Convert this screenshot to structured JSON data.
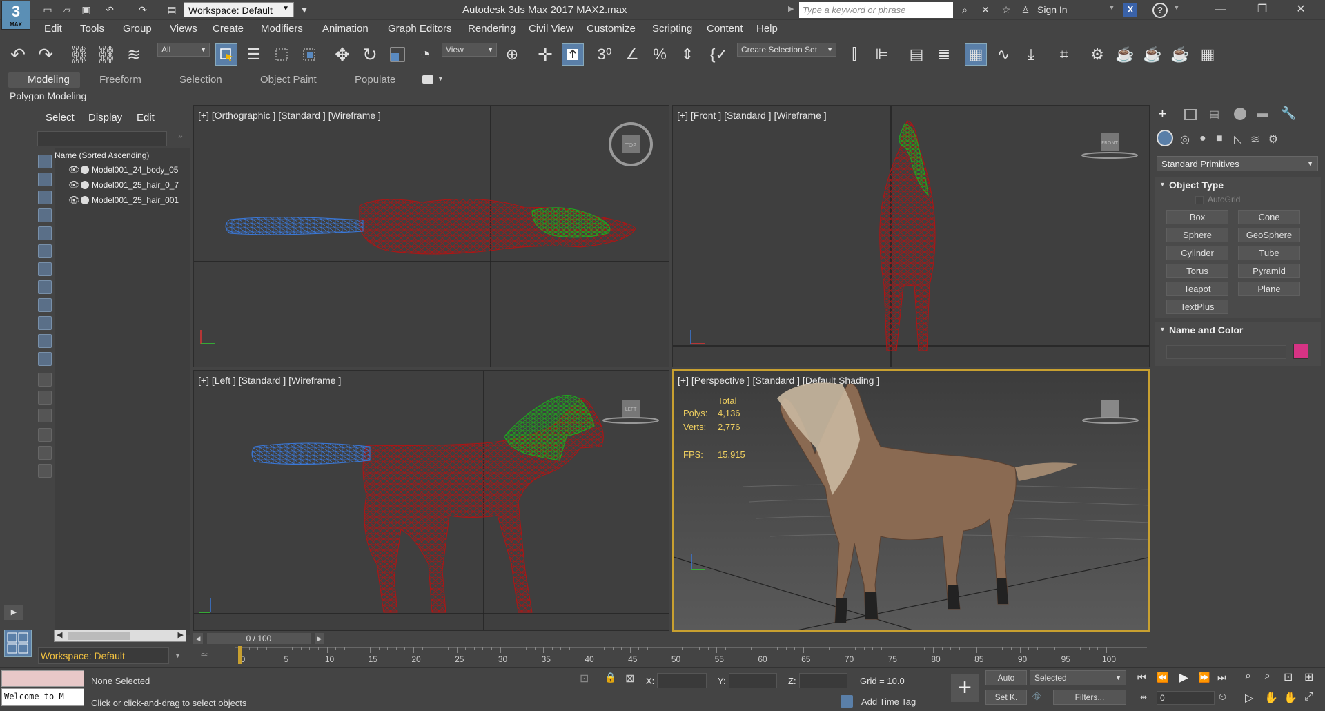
{
  "app": {
    "logo_text": "3",
    "logo_sub": "MAX",
    "workspace": "Workspace: Default",
    "title": "Autodesk 3ds Max 2017      MAX2.max",
    "search_placeholder": "Type a keyword or phrase",
    "sign_in": "Sign In"
  },
  "menu": [
    "Edit",
    "Tools",
    "Group",
    "Views",
    "Create",
    "Modifiers",
    "Animation",
    "Graph Editors",
    "Rendering",
    "Civil View",
    "Customize",
    "Scripting",
    "Content",
    "Help"
  ],
  "toolbar": {
    "filter": "All",
    "view": "View",
    "selection_set": "Create Selection Set"
  },
  "ribbon_tabs": [
    "Modeling",
    "Freeform",
    "Selection",
    "Object Paint",
    "Populate"
  ],
  "polygon_modeling": "Polygon Modeling",
  "explorer": {
    "tabs": [
      "Select",
      "Display",
      "Edit"
    ],
    "header": "Name (Sorted Ascending)",
    "items": [
      "Model001_24_body_05",
      "Model001_25_hair_0_7",
      "Model001_25_hair_001"
    ],
    "workspace_label": "Workspace: Default"
  },
  "viewports": {
    "top_left": "[+] [Orthographic ] [Standard ] [Wireframe ]",
    "top_right": "[+] [Front ] [Standard ] [Wireframe ]",
    "bottom_left": "[+] [Left ] [Standard ] [Wireframe ]",
    "bottom_right": "[+] [Perspective ] [Standard ] [Default Shading ]",
    "stats": {
      "total_label": "Total",
      "polys_label": "Polys:",
      "polys": "4,136",
      "verts_label": "Verts:",
      "verts": "2,776",
      "fps_label": "FPS:",
      "fps": "15.915"
    },
    "viewcube_front": "FRONT",
    "viewcube_left": "LEFT",
    "viewcube_top": "TOP"
  },
  "command_panel": {
    "dropdown": "Standard Primitives",
    "object_type_title": "Object Type",
    "autogrid": "AutoGrid",
    "buttons": [
      "Box",
      "Cone",
      "Sphere",
      "GeoSphere",
      "Cylinder",
      "Tube",
      "Torus",
      "Pyramid",
      "Teapot",
      "Plane",
      "TextPlus"
    ],
    "name_color_title": "Name and Color",
    "swatch_color": "#d63384"
  },
  "timeline": {
    "slider": "0 / 100",
    "ticks": [
      "0",
      "5",
      "10",
      "15",
      "20",
      "25",
      "30",
      "35",
      "40",
      "45",
      "50",
      "55",
      "60",
      "65",
      "70",
      "75",
      "80",
      "85",
      "90",
      "95",
      "100"
    ]
  },
  "status": {
    "listener": "Welcome to M",
    "selection": "None Selected",
    "prompt": "Click or click-and-drag to select objects",
    "x_label": "X:",
    "y_label": "Y:",
    "z_label": "Z:",
    "grid": "Grid = 10.0",
    "add_time_tag": "Add Time Tag",
    "auto": "Auto",
    "selected": "Selected",
    "set_key": "Set K.",
    "filters": "Filters...",
    "frame": "0"
  },
  "colors": {
    "wire_red": "#b01414",
    "wire_green": "#1ea81e",
    "wire_blue": "#3a78d8",
    "accent": "#5a7fa8"
  }
}
